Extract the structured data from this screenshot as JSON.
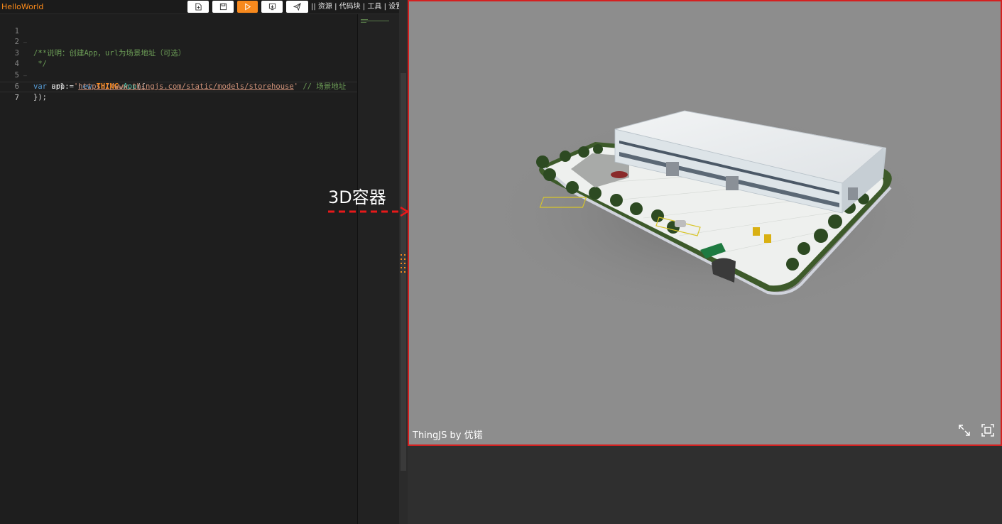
{
  "toolbar": {
    "title": "HelloWorld",
    "links": [
      "|| 资源",
      "| 代码块",
      "| 工具",
      "| 设置"
    ]
  },
  "editor": {
    "line_numbers": [
      "1",
      "2",
      "3",
      "4",
      "5",
      "6",
      "7"
    ],
    "lines": {
      "l1": "/**",
      "l2": " * 说明：创建App，url为场景地址（可选）",
      "l3": " */",
      "l4_kw": "var",
      "l4_var": " app = ",
      "l4_new": "new",
      "l4_cls": "THING",
      "l4_dot": ".",
      "l4_fn": "App",
      "l4_end": "({",
      "l5_key": "    url: ",
      "l5_q1": "'",
      "l5_url": "https://www.thingjs.com/static/models/storehouse",
      "l5_q2": "'",
      "l5_com": " // 场景地址",
      "l6": "});"
    }
  },
  "viewer": {
    "brand": "ThingJS by 优锘",
    "border_color": "#d42020",
    "background": "#8d8d8d"
  },
  "annotation": {
    "label": "3D容器",
    "color": "#e8191a"
  },
  "icons": {
    "new": "new-file-icon",
    "save": "save-icon",
    "run": "run-icon",
    "publish": "publish-icon",
    "share": "send-icon",
    "fullscreen": "expand-icon",
    "screenshot": "screenshot-icon"
  },
  "colors": {
    "accent": "#f7891d",
    "editor_bg": "#1e1e1e"
  }
}
